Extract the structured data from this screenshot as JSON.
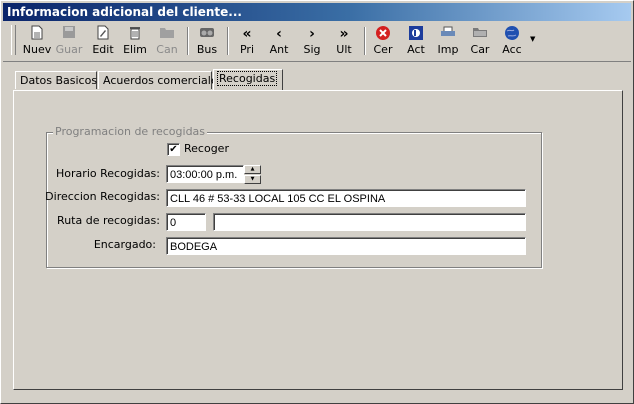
{
  "window": {
    "title": "Informacion adicional del cliente..."
  },
  "toolbar": {
    "buttons": [
      {
        "label": "Nuev",
        "icon": "new-doc-icon",
        "enabled": true
      },
      {
        "label": "Guar",
        "icon": "save-icon",
        "enabled": false
      },
      {
        "label": "Edit",
        "icon": "edit-icon",
        "enabled": true
      },
      {
        "label": "Elim",
        "icon": "trash-icon",
        "enabled": true
      },
      {
        "label": "Can",
        "icon": "cancel-icon",
        "enabled": false
      },
      {
        "label": "Bus",
        "icon": "binoculars-icon",
        "enabled": true
      },
      {
        "label": "Pri",
        "icon": "first-icon",
        "glyph": "«",
        "enabled": true
      },
      {
        "label": "Ant",
        "icon": "previous-icon",
        "glyph": "‹",
        "enabled": true
      },
      {
        "label": "Sig",
        "icon": "next-icon",
        "glyph": "›",
        "enabled": true
      },
      {
        "label": "Ult",
        "icon": "last-icon",
        "glyph": "»",
        "enabled": true
      },
      {
        "label": "Cer",
        "icon": "close-red-icon",
        "enabled": true
      },
      {
        "label": "Act",
        "icon": "refresh-icon",
        "enabled": true
      },
      {
        "label": "Imp",
        "icon": "printer-icon",
        "enabled": true
      },
      {
        "label": "Car",
        "icon": "folder-icon",
        "enabled": true
      },
      {
        "label": "Acc",
        "icon": "globe-icon",
        "enabled": true
      }
    ]
  },
  "tabs": [
    {
      "label": "Datos Basicos"
    },
    {
      "label": "Acuerdos comerciales"
    },
    {
      "label": "Recogidas",
      "active": true
    }
  ],
  "form": {
    "group_title": "Programacion de recogidas",
    "recoger": {
      "label": "Recoger",
      "checked": true,
      "mark": "✔"
    },
    "horario": {
      "label": "Horario Recogidas:",
      "value": "03:00:00 p.m."
    },
    "direccion": {
      "label": "Direccion Recogidas:",
      "value": "CLL 46 # 53-33 LOCAL 105 CC EL OSPINA"
    },
    "ruta": {
      "label": "Ruta de recogidas:",
      "code": "0",
      "name": ""
    },
    "encargado": {
      "label": "Encargado:",
      "value": "BODEGA"
    }
  },
  "colors": {
    "face": "#d4d0c8",
    "title_start": "#0a246a",
    "title_end": "#a6caf0",
    "close_red": "#d42020"
  }
}
